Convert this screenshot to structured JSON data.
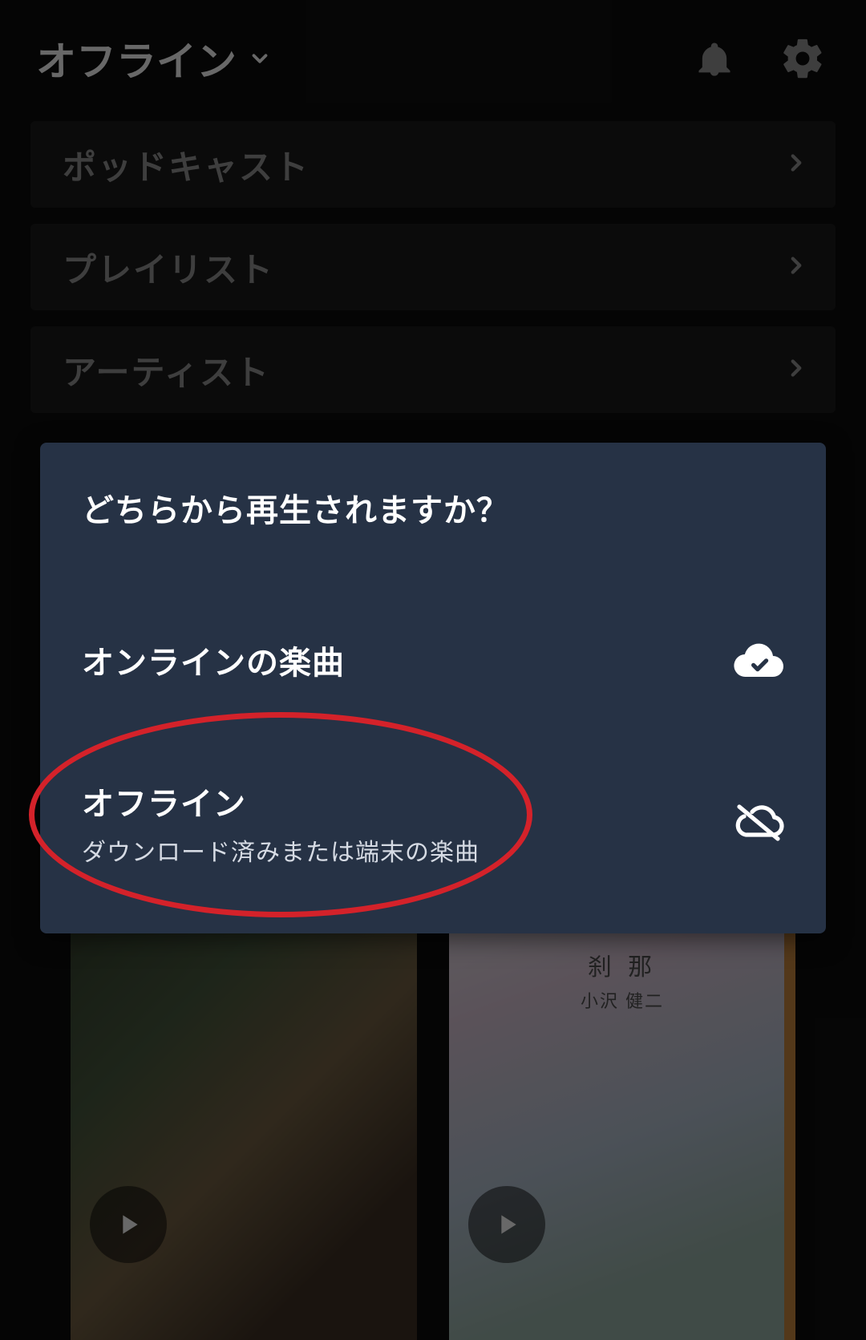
{
  "header": {
    "title": "オフライン",
    "icons": {
      "bell": "bell-icon",
      "gear": "gear-icon",
      "caret": "caret-down-icon"
    }
  },
  "nav": {
    "items": [
      {
        "label": "ポッドキャスト"
      },
      {
        "label": "プレイリスト"
      },
      {
        "label": "アーティスト"
      }
    ]
  },
  "dialog": {
    "title": "どちらから再生されますか？",
    "options": [
      {
        "label": "オンラインの楽曲",
        "sub": "",
        "icon": "cloud-check-icon"
      },
      {
        "label": "オフライン",
        "sub": "ダウンロード済みまたは端末の楽曲",
        "icon": "cloud-off-icon"
      }
    ]
  },
  "albums": [
    {
      "title_line1": "",
      "title_line2": ""
    },
    {
      "title_line1": "刹 那",
      "title_line2": "小沢 健二"
    }
  ],
  "colors": {
    "dialog_bg": "#263245",
    "nav_item_bg": "#1a1a1a",
    "annotation": "#d4222a"
  }
}
